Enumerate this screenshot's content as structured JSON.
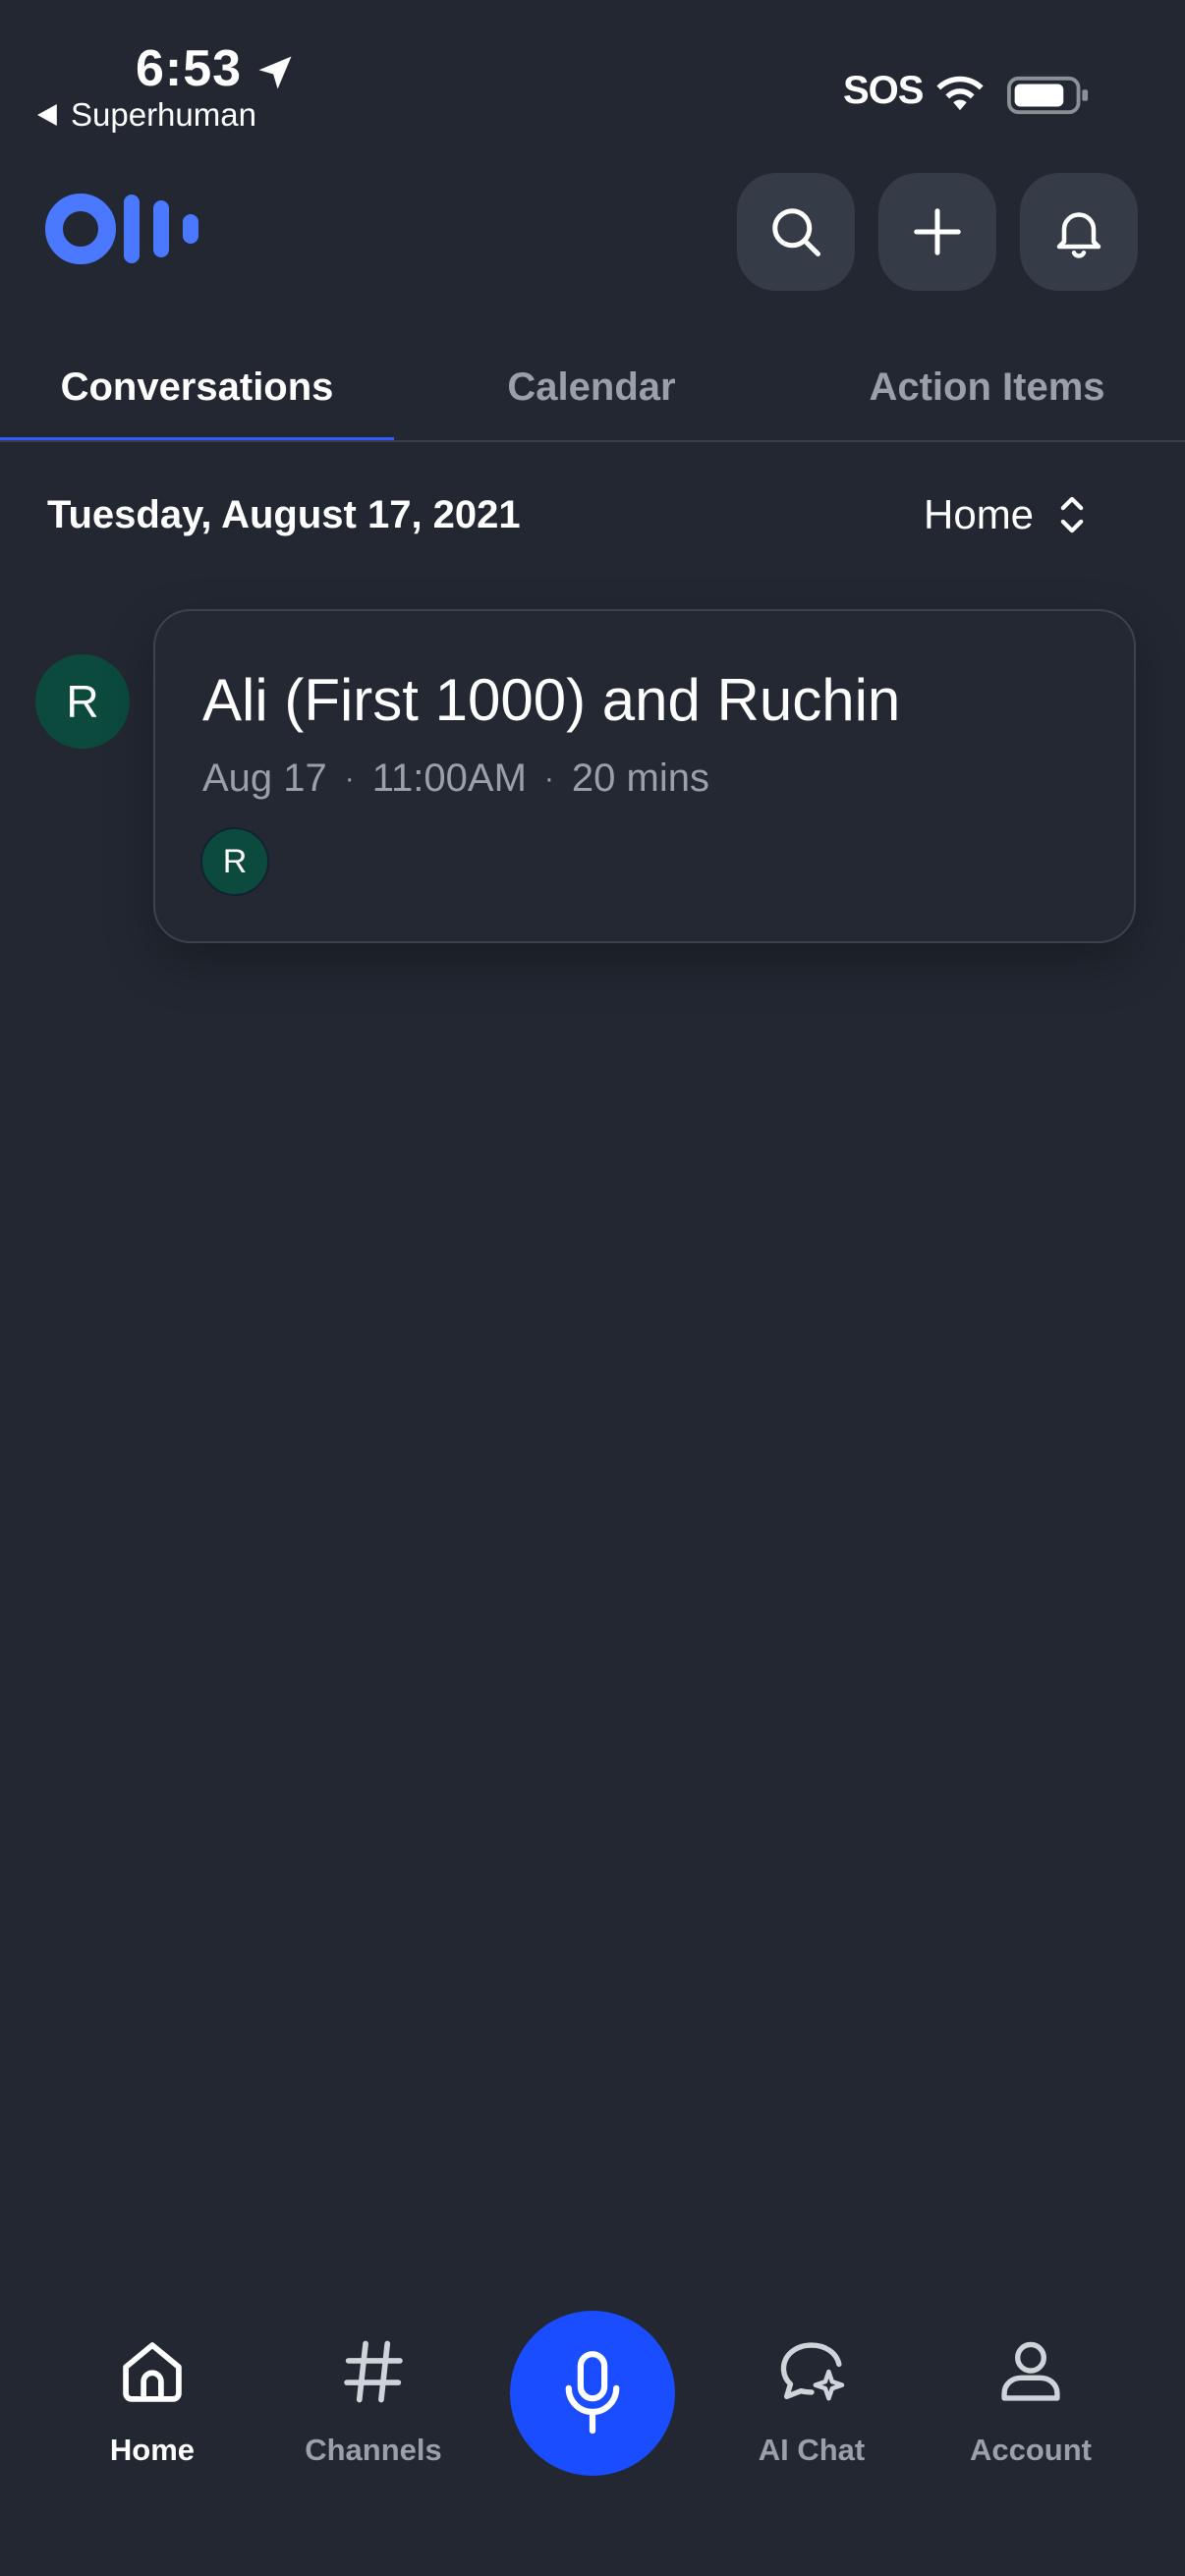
{
  "status_bar": {
    "time": "6:53",
    "back_app": "Superhuman",
    "carrier": "SOS"
  },
  "header": {
    "logo_icon": "otter-logo",
    "actions": [
      "search-icon",
      "plus-icon",
      "bell-icon"
    ]
  },
  "tabs": [
    {
      "label": "Conversations",
      "active": true
    },
    {
      "label": "Calendar",
      "active": false
    },
    {
      "label": "Action Items",
      "active": false
    }
  ],
  "list": {
    "date": "Tuesday, August 17, 2021",
    "folder": "Home"
  },
  "conversations": [
    {
      "avatar_initial": "R",
      "title": "Ali (First 1000) and Ruchin",
      "date": "Aug 17",
      "time": "11:00AM",
      "duration": "20 mins",
      "participants": [
        "R"
      ]
    }
  ],
  "bottom_nav": {
    "items": [
      {
        "label": "Home",
        "icon": "home-icon",
        "active": true
      },
      {
        "label": "Channels",
        "icon": "hash-icon",
        "active": false
      },
      {
        "label": "AI Chat",
        "icon": "ai-chat-icon",
        "active": false
      },
      {
        "label": "Account",
        "icon": "account-icon",
        "active": false
      }
    ],
    "record_icon": "microphone-icon"
  },
  "colors": {
    "background": "#222731",
    "accent": "#2d5bff",
    "record": "#1a4dff",
    "avatar": "#0b4a3d",
    "muted_text": "#9aa0a9"
  }
}
